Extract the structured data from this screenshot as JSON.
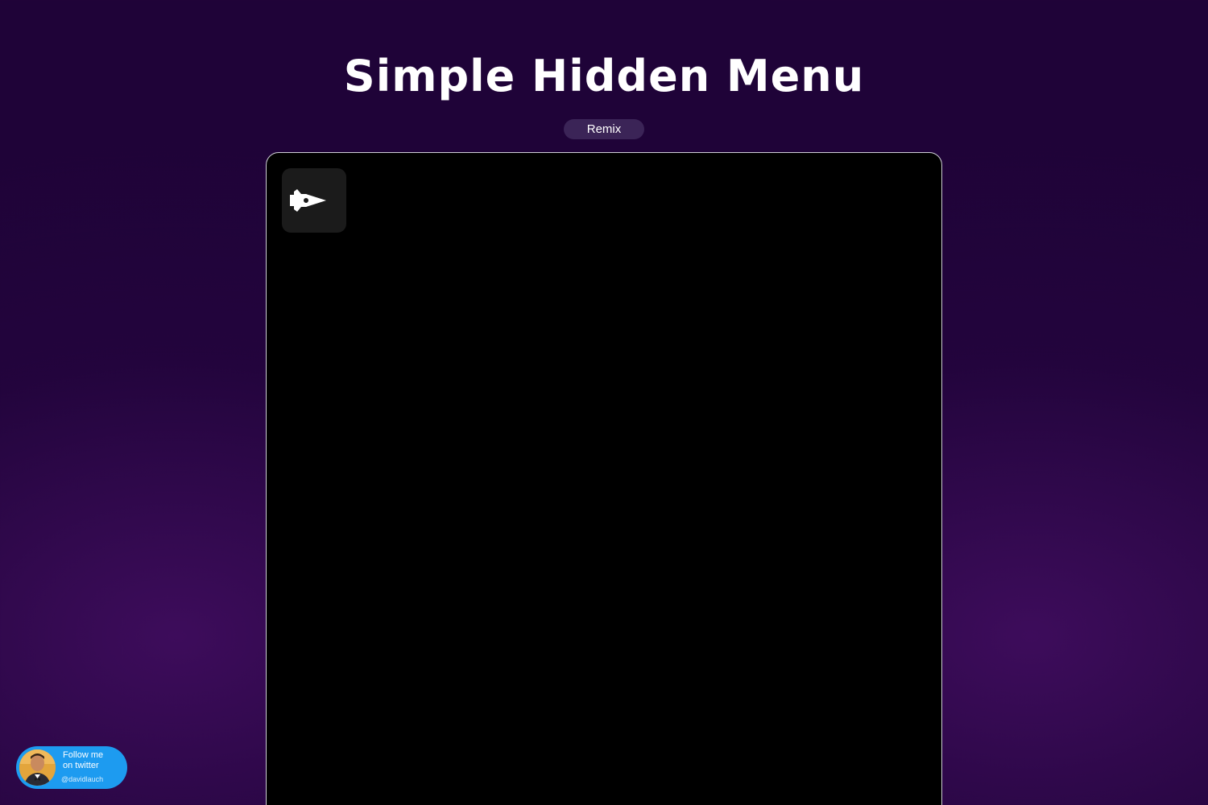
{
  "header": {
    "title": "Simple Hidden Menu",
    "remix_label": "Remix"
  },
  "demo": {
    "menu_toggle_icon": "fish-pen-icon"
  },
  "twitter_badge": {
    "follow_label": "Follow me\non twitter",
    "handle": "@davidlauch",
    "avatar_icon": "avatar-photo"
  },
  "colors": {
    "background": "#1f0338",
    "background_glow": "#561478",
    "remix_pill": "#3b2457",
    "frame_background": "#000000",
    "toggle_background": "#1b1b1b",
    "twitter_blue": "#1d9bf0"
  }
}
